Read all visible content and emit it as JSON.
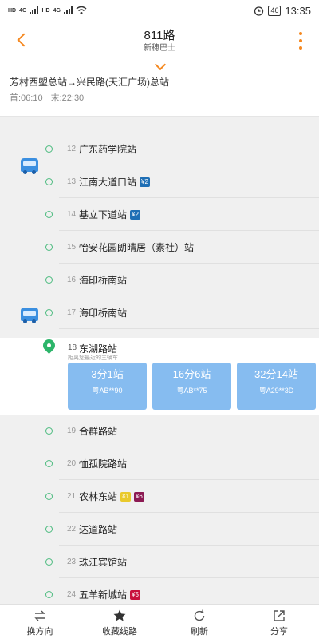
{
  "status_bar": {
    "net_label_1": "HD",
    "net_label_2": "HD",
    "sig_label_1": "4G",
    "sig_label_2": "4G",
    "battery": "46",
    "time": "13:35"
  },
  "header": {
    "title": "811路",
    "operator": "新穗巴士"
  },
  "route": {
    "direction": "芳村西塱总站→兴民路(天汇广场)总站",
    "first": "首:06:10",
    "last": "末:22:30"
  },
  "stops": [
    {
      "num": "12",
      "name": "广东药学院站",
      "metro": []
    },
    {
      "num": "13",
      "name": "江南大道口站",
      "metro": [
        {
          "label": "¥2",
          "color": "#1f6fb5"
        }
      ]
    },
    {
      "num": "14",
      "name": "基立下道站",
      "metro": [
        {
          "label": "¥2",
          "color": "#1f6fb5"
        }
      ]
    },
    {
      "num": "15",
      "name": "怡安花园朗晴居（素社）站",
      "metro": []
    },
    {
      "num": "16",
      "name": "海印桥南站",
      "metro": []
    },
    {
      "num": "17",
      "name": "海印桥南站",
      "metro": []
    }
  ],
  "current_stop": {
    "num": "18",
    "name": "东湖路站",
    "hint": "距离您最近的三辆车",
    "arrivals": [
      {
        "eta": "3分1站",
        "plate": "粤AB**90"
      },
      {
        "eta": "16分6站",
        "plate": "粤AB**75"
      },
      {
        "eta": "32分14站",
        "plate": "粤A29**3D"
      }
    ]
  },
  "stops_after": [
    {
      "num": "19",
      "name": "合群路站",
      "metro": []
    },
    {
      "num": "20",
      "name": "恤孤院路站",
      "metro": []
    },
    {
      "num": "21",
      "name": "农林东站",
      "metro": [
        {
          "label": "¥1",
          "color": "#e9c92c"
        },
        {
          "label": "¥6",
          "color": "#8c1a53"
        }
      ]
    },
    {
      "num": "22",
      "name": "达道路站",
      "metro": []
    },
    {
      "num": "23",
      "name": "珠江宾馆站",
      "metro": []
    },
    {
      "num": "24",
      "name": "五羊新城站",
      "metro": [
        {
          "label": "¥5",
          "color": "#c8103c"
        }
      ]
    }
  ],
  "toolbar": {
    "reverse": "换方向",
    "favorite": "收藏线路",
    "refresh": "刷新",
    "share": "分享"
  },
  "colors": {
    "accent": "#f5881f",
    "line": "#4cbb7f",
    "card": "#86bcf0",
    "bus": "#3b8fe0"
  }
}
